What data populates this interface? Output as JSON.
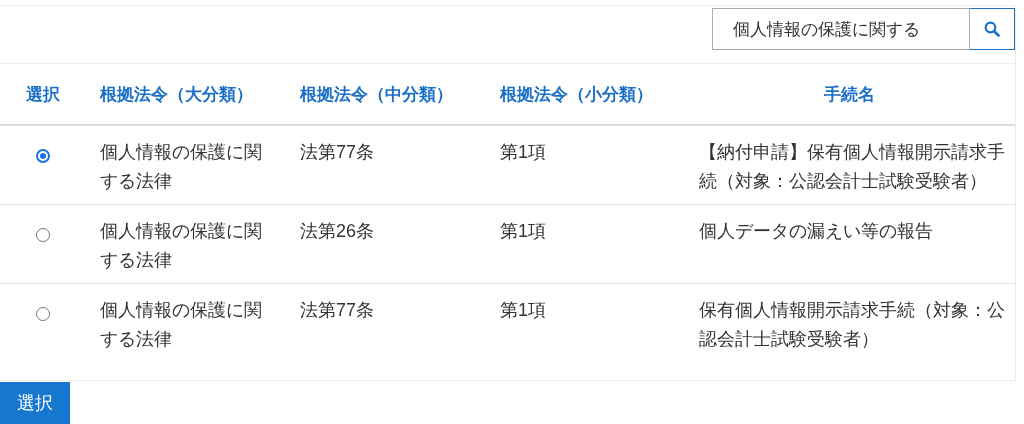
{
  "search": {
    "value": "個人情報の保護に関する"
  },
  "table": {
    "selection_header": "選択",
    "columns": [
      "根拠法令（大分類）",
      "根拠法令（中分類）",
      "根拠法令（小分類）",
      "手続名"
    ],
    "rows": [
      {
        "selected": true,
        "cells": [
          "個人情報の保護に関する法律",
          "法第77条",
          "第1項",
          "【納付申請】保有個人情報開示請求手続（対象：公認会計士試験受験者）"
        ]
      },
      {
        "selected": false,
        "cells": [
          "個人情報の保護に関する法律",
          "法第26条",
          "第1項",
          "個人データの漏えい等の報告"
        ]
      },
      {
        "selected": false,
        "cells": [
          "個人情報の保護に関する法律",
          "法第77条",
          "第1項",
          "保有個人情報開示請求手続（対象：公認会計士試験受験者）"
        ]
      }
    ]
  },
  "submit_button": "選択"
}
